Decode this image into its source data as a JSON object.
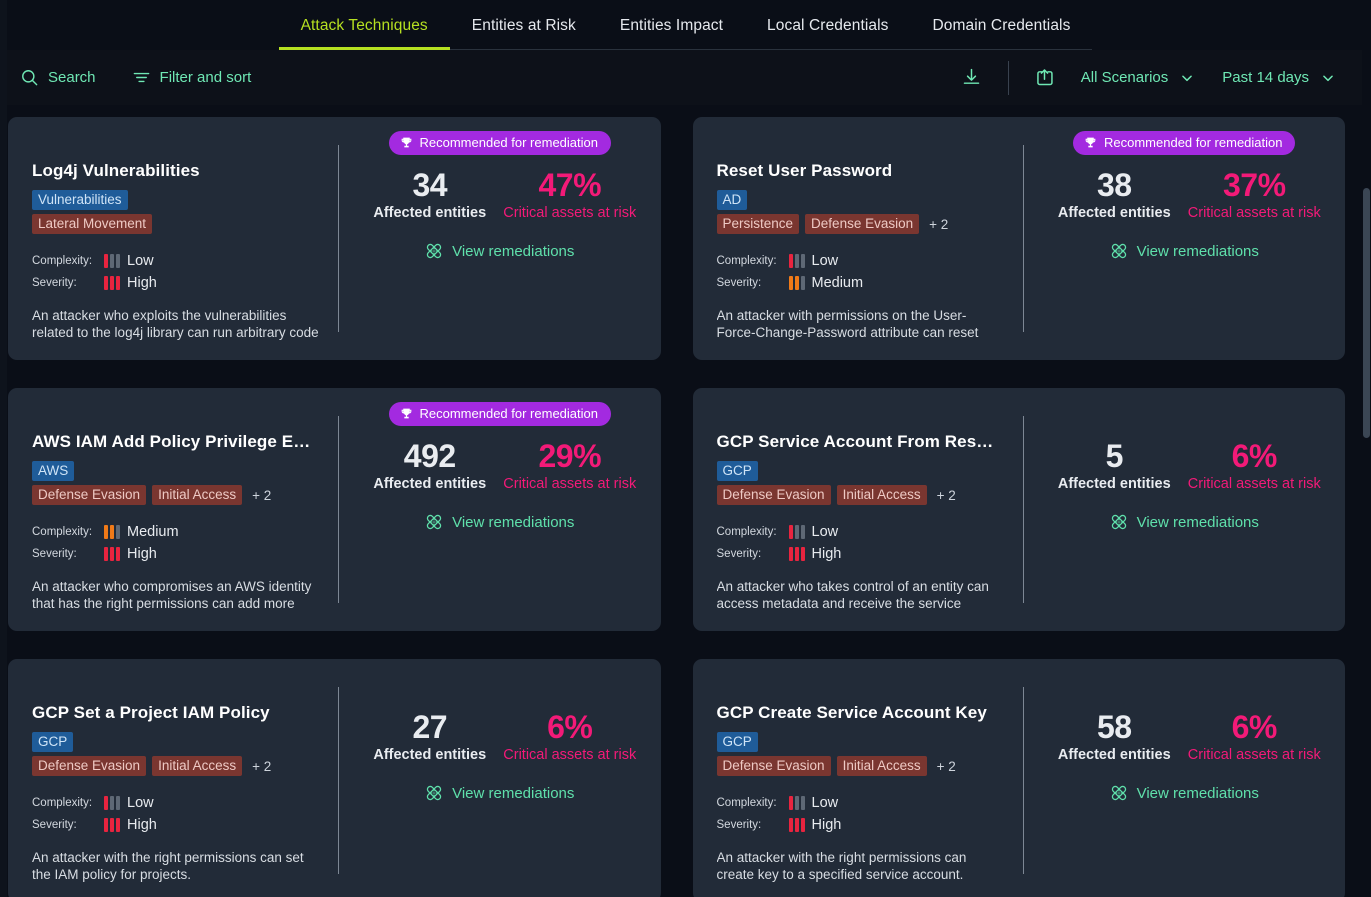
{
  "tabs": [
    {
      "label": "Attack Techniques",
      "active": true
    },
    {
      "label": "Entities at Risk",
      "active": false
    },
    {
      "label": "Entities Impact",
      "active": false
    },
    {
      "label": "Local Credentials",
      "active": false
    },
    {
      "label": "Domain Credentials",
      "active": false
    }
  ],
  "toolbar": {
    "search_label": "Search",
    "filter_label": "Filter and sort",
    "download_icon": "download-icon",
    "share_icon": "share-icon",
    "scenario_select": "All Scenarios",
    "date_select": "Past 14 days"
  },
  "labels": {
    "complexity": "Complexity:",
    "severity": "Severity:",
    "affected_entities": "Affected entities",
    "critical_assets": "Critical assets at risk",
    "view_remediations": "View remediations",
    "recommended": "Recommended for remediation"
  },
  "cards": [
    {
      "title": "Log4j Vulnerabilities",
      "platform_tag": "Vulnerabilities",
      "tactic_tags": [
        "Lateral Movement"
      ],
      "more_tags": "",
      "complexity": "Low",
      "complexity_level": 1,
      "severity": "High",
      "severity_level": 3,
      "description": "An attacker who exploits the vulnerabilities related to the log4j library can run arbitrary code",
      "recommended": true,
      "affected_entities": "34",
      "critical_assets": "47%"
    },
    {
      "title": "Reset User Password",
      "platform_tag": "AD",
      "tactic_tags": [
        "Persistence",
        "Defense Evasion"
      ],
      "more_tags": "+ 2",
      "complexity": "Low",
      "complexity_level": 1,
      "severity": "Medium",
      "severity_level": 2,
      "description": "An attacker with permissions on the User-Force-Change-Password attribute can reset your",
      "recommended": true,
      "affected_entities": "38",
      "critical_assets": "37%"
    },
    {
      "title": "AWS IAM Add Policy Privilege Escalation",
      "platform_tag": "AWS",
      "tactic_tags": [
        "Defense Evasion",
        "Initial Access"
      ],
      "more_tags": "+ 2",
      "complexity": "Medium",
      "complexity_level": 2,
      "severity": "High",
      "severity_level": 3,
      "description": "An attacker who compromises an AWS identity that has the right permissions can add more",
      "recommended": true,
      "affected_entities": "492",
      "critical_assets": "29%"
    },
    {
      "title": "GCP Service Account From Resource",
      "platform_tag": "GCP",
      "tactic_tags": [
        "Defense Evasion",
        "Initial Access"
      ],
      "more_tags": "+ 2",
      "complexity": "Low",
      "complexity_level": 1,
      "severity": "High",
      "severity_level": 3,
      "description": "An attacker who takes control of an entity can access metadata and receive the service account",
      "recommended": false,
      "affected_entities": "5",
      "critical_assets": "6%"
    },
    {
      "title": "GCP Set a Project IAM Policy",
      "platform_tag": "GCP",
      "tactic_tags": [
        "Defense Evasion",
        "Initial Access"
      ],
      "more_tags": "+ 2",
      "complexity": "Low",
      "complexity_level": 1,
      "severity": "High",
      "severity_level": 3,
      "description": "An attacker with the right permissions can set the IAM policy for projects.",
      "recommended": false,
      "affected_entities": "27",
      "critical_assets": "6%"
    },
    {
      "title": "GCP Create Service Account Key",
      "platform_tag": "GCP",
      "tactic_tags": [
        "Defense Evasion",
        "Initial Access"
      ],
      "more_tags": "+ 2",
      "complexity": "Low",
      "complexity_level": 1,
      "severity": "High",
      "severity_level": 3,
      "description": "An attacker with the right permissions can create key to a specified service account.",
      "recommended": false,
      "affected_entities": "58",
      "critical_assets": "6%"
    }
  ],
  "colors": {
    "accent_lime": "#b6e021",
    "accent_mint": "#6fe8b4",
    "pink": "#f31a78",
    "purple": "#a32ae0",
    "red": "#e8243f",
    "orange": "#f07a18",
    "card_bg": "#222b38",
    "page_bg": "#0a0e17"
  }
}
